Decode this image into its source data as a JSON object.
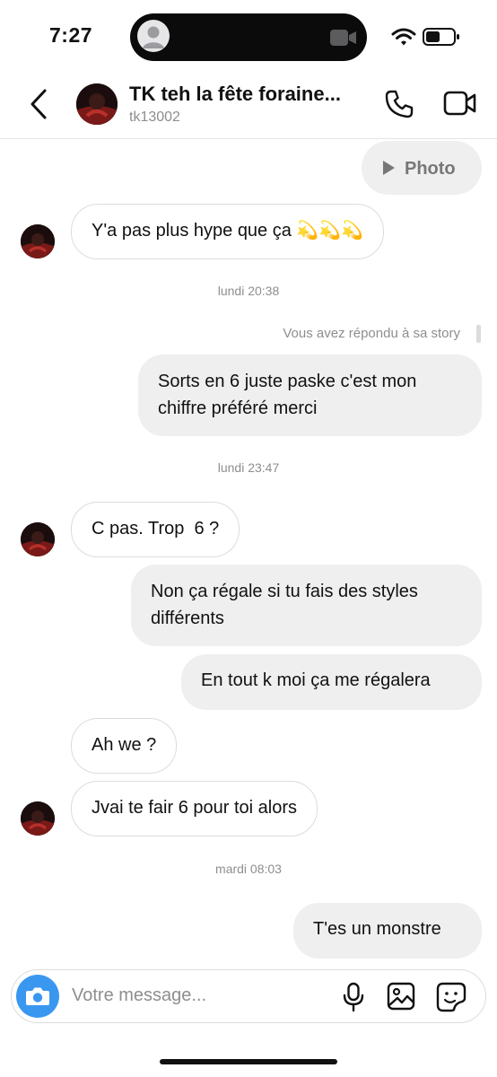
{
  "status": {
    "time": "7:27"
  },
  "header": {
    "title": "TK teh la fête foraine...",
    "username": "tk13002"
  },
  "colors": {
    "accent": "#3a97f0",
    "incoming_border": "#dcdcdc",
    "outgoing_bg": "#efefef"
  },
  "messages": {
    "photo_label": "Photo",
    "m1": "Y'a pas plus hype que ça 💫💫💫",
    "sep1": "lundi 20:38",
    "reply_note": "Vous avez répondu à sa story",
    "m2_line1": "Sorts en 6 juste paske c'est mon",
    "m2_line2": "chiffre préféré merci",
    "sep2": "lundi 23:47",
    "m3": "C pas. Trop  6 ?",
    "m4_line1": "Non ça régale si tu fais des styles",
    "m4_line2": "différents",
    "m5": "En tout k moi ça me régalera",
    "m6": "Ah we ?",
    "m7": "Jvai te fair 6 pour toi alors",
    "sep3": "mardi 08:03",
    "m8": "T'es un monstre"
  },
  "composer": {
    "placeholder": "Votre message..."
  },
  "icons": [
    "back-chevron-icon",
    "phone-icon",
    "video-camera-icon",
    "camera-icon",
    "microphone-icon",
    "gallery-icon",
    "sticker-icon",
    "play-icon"
  ]
}
